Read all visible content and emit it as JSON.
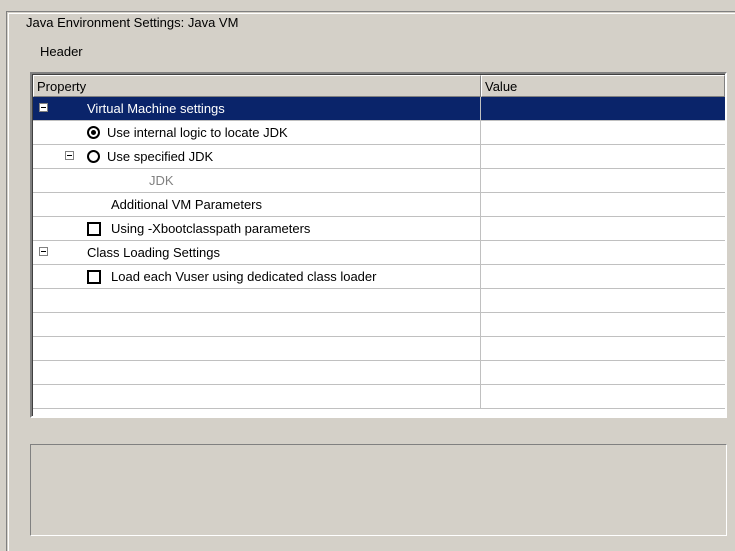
{
  "group": {
    "title": "Java Environment Settings: Java VM"
  },
  "header_label": "Header",
  "grid": {
    "columns": [
      "Property",
      "Value"
    ],
    "rows": [
      {
        "label": "Virtual Machine settings",
        "value": ""
      },
      {
        "label": "Use internal logic to locate JDK",
        "value": ""
      },
      {
        "label": "Use specified JDK",
        "value": ""
      },
      {
        "label": "JDK",
        "value": ""
      },
      {
        "label": "Additional VM Parameters",
        "value": ""
      },
      {
        "label": "Using -Xbootclasspath parameters",
        "value": ""
      },
      {
        "label": "Class Loading Settings",
        "value": ""
      },
      {
        "label": "Load each Vuser using dedicated class loader",
        "value": ""
      }
    ]
  },
  "colors": {
    "selection": "#0a246a",
    "window_bg": "#d4d0c8"
  }
}
